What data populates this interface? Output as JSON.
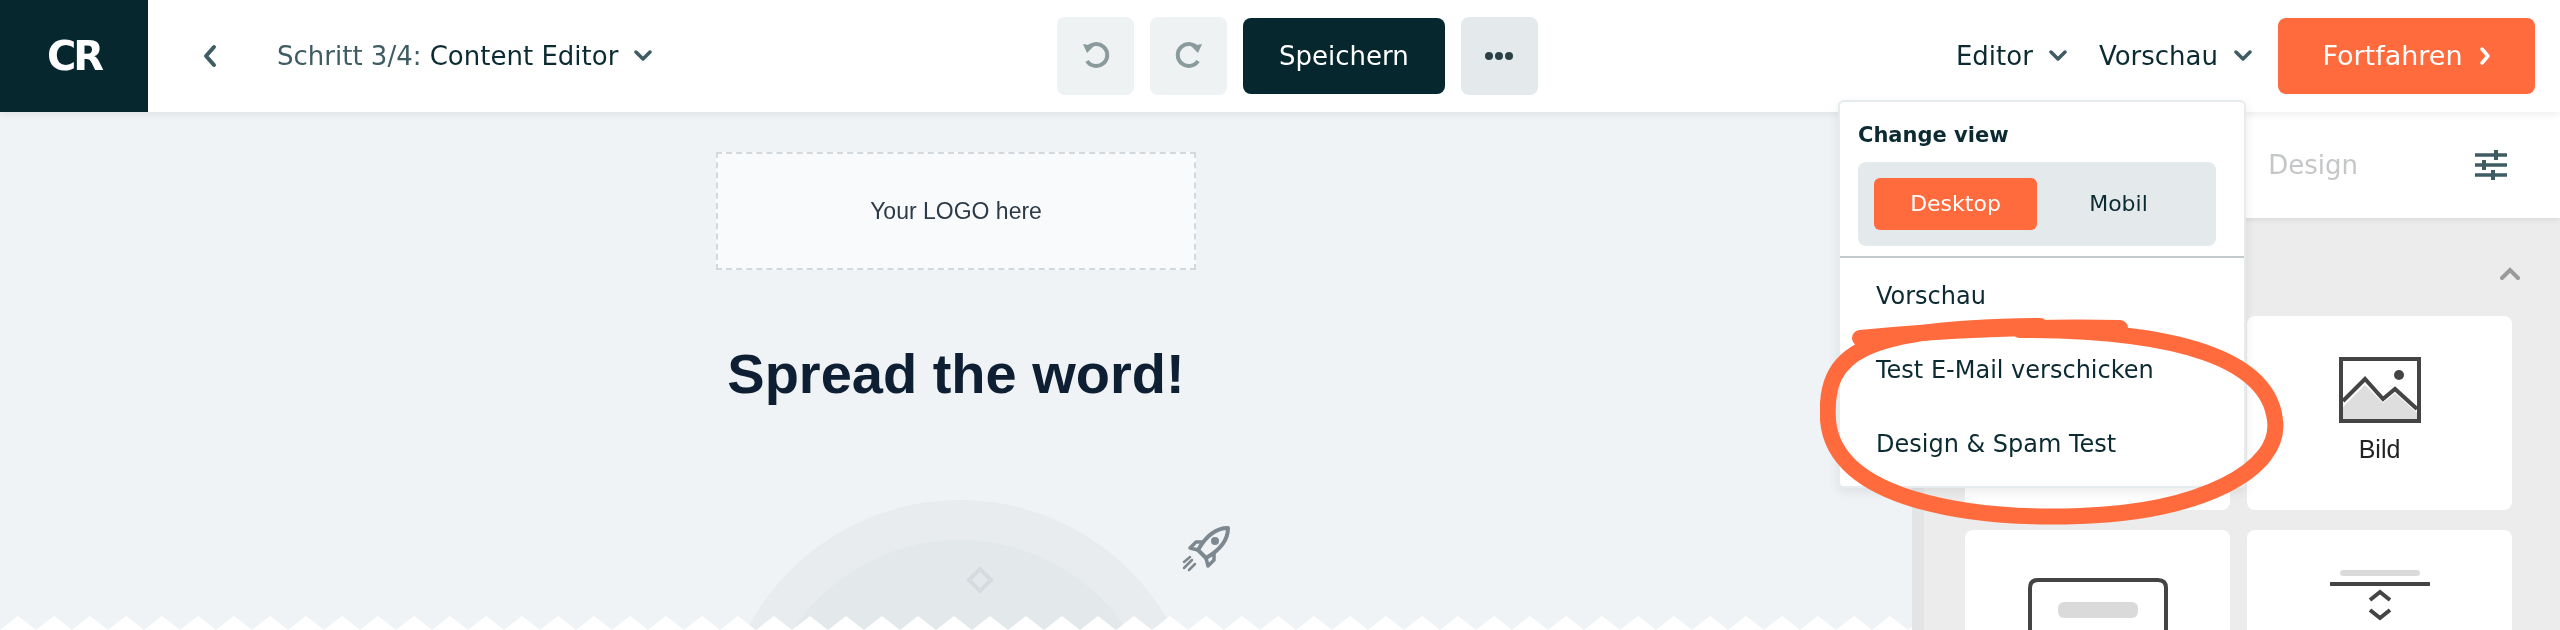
{
  "header": {
    "logo": "CR",
    "title": "Schritt 3/4: **Content Editor**",
    "save": "Speichern",
    "menus": [
      "Editor",
      "Vorschau"
    ],
    "continue": "Fortfahren"
  },
  "canvas": {
    "logo_placeholder": "Your LOGO here",
    "heading": "Spread the word!"
  },
  "panel": {
    "tabs": [
      {
        "label": "Design",
        "selected": false
      }
    ],
    "blocks": [
      {
        "kind": "blank"
      },
      {
        "kind": "image",
        "label": "Bild"
      },
      {
        "kind": "button"
      },
      {
        "kind": "spacer"
      }
    ]
  },
  "dropdown": {
    "title": "Change view",
    "views": [
      {
        "label": "Desktop",
        "selected": true
      },
      {
        "label": "Mobil",
        "selected": false
      }
    ],
    "items": [
      "Vorschau",
      "Test E-Mail verschicken",
      "Design & Spam Test"
    ]
  }
}
